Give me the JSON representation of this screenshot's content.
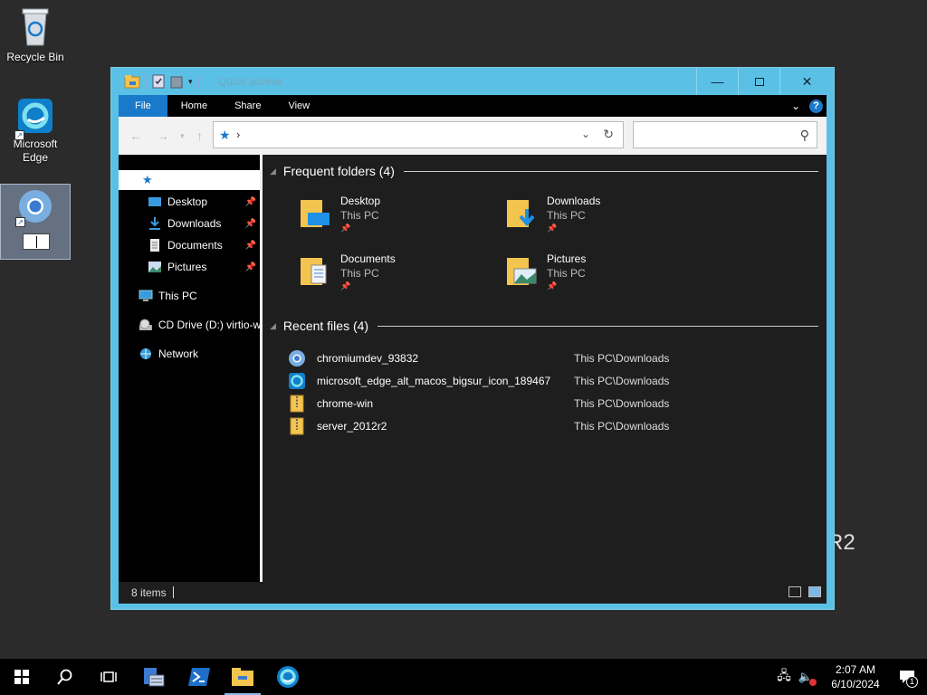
{
  "desktop": {
    "icons": [
      {
        "label": "Recycle Bin"
      },
      {
        "label": "Microsoft Edge"
      }
    ],
    "background_text": "R2"
  },
  "window": {
    "title": "Quick access",
    "ribbon_tabs": [
      "File",
      "Home",
      "Share",
      "View"
    ],
    "help_label": "?",
    "address_separator": "›",
    "search_placeholder": ""
  },
  "nav": {
    "quick_access": "Quick access",
    "items": [
      {
        "label": "Desktop"
      },
      {
        "label": "Downloads"
      },
      {
        "label": "Documents"
      },
      {
        "label": "Pictures"
      }
    ],
    "this_pc": "This PC",
    "cd_drive": "CD Drive (D:) virtio-w",
    "network": "Network"
  },
  "frequent": {
    "heading": "Frequent folders (4)",
    "folders": [
      {
        "name": "Desktop",
        "location": "This PC"
      },
      {
        "name": "Downloads",
        "location": "This PC"
      },
      {
        "name": "Documents",
        "location": "This PC"
      },
      {
        "name": "Pictures",
        "location": "This PC"
      }
    ]
  },
  "recent": {
    "heading": "Recent files (4)",
    "files": [
      {
        "name": "chromiumdev_93832",
        "path": "This PC\\Downloads"
      },
      {
        "name": "microsoft_edge_alt_macos_bigsur_icon_189467",
        "path": "This PC\\Downloads"
      },
      {
        "name": "chrome-win",
        "path": "This PC\\Downloads"
      },
      {
        "name": "server_2012r2",
        "path": "This PC\\Downloads"
      }
    ]
  },
  "status": {
    "items": "8 items"
  },
  "taskbar": {
    "time": "2:07 AM",
    "date": "6/10/2024",
    "notification_count": "1"
  },
  "colors": {
    "accent": "#1979ca",
    "titlebar": "#5bc0e6",
    "folder": "#f3c44e"
  }
}
